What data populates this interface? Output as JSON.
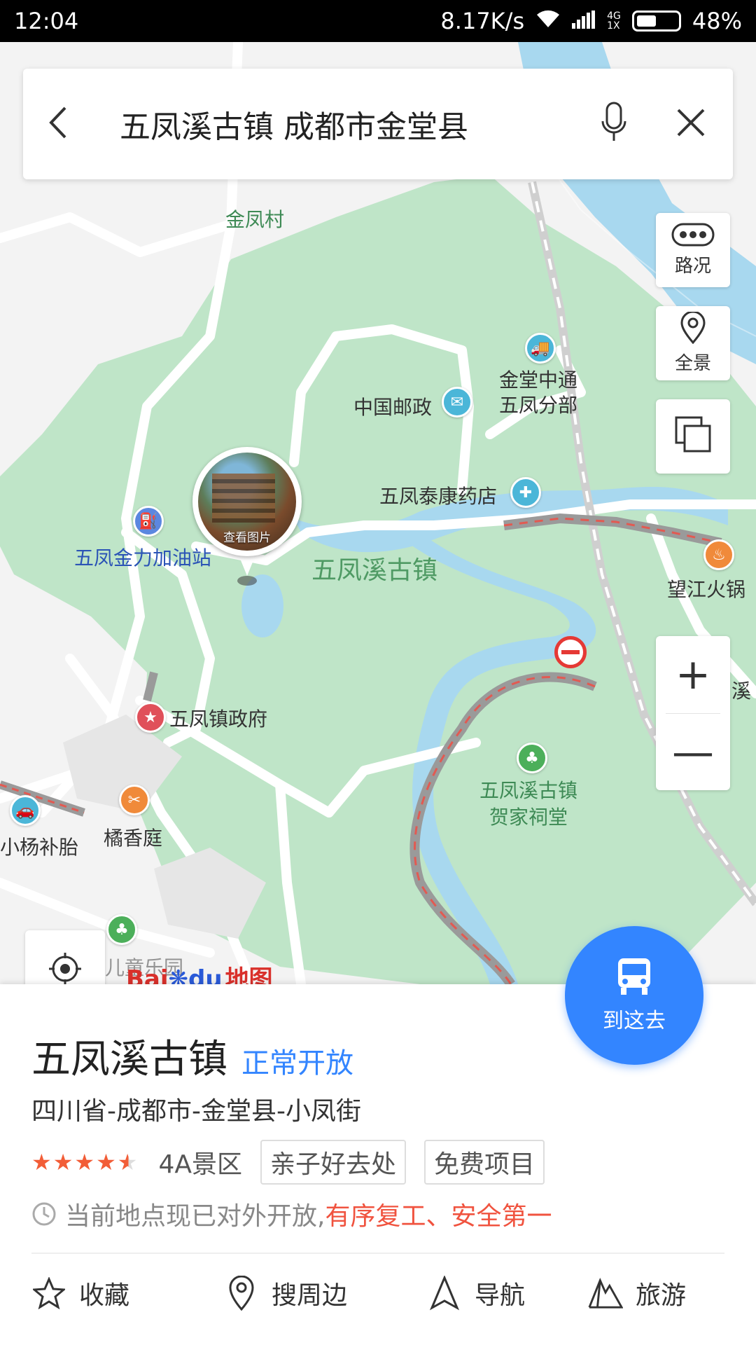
{
  "status_bar": {
    "time": "12:04",
    "speed": "8.17K/s",
    "net_top": "4G",
    "net_bottom": "1X",
    "battery": "48%",
    "battery_level": 0.48
  },
  "search": {
    "query": "五凤溪古镇 成都市金堂县"
  },
  "map": {
    "labels": {
      "village": "金凤村",
      "post": "中国邮政",
      "express": "金堂中通\n五凤分部",
      "pharmacy": "五凤泰康药店",
      "gas": "五凤金力加油站",
      "town": "五凤溪古镇",
      "hotpot": "望江火锅",
      "river_partial": "溪",
      "gov": "五凤镇政府",
      "hall": "五凤溪古镇\n贺家祠堂",
      "restaurant": "橘香庭",
      "tire": "小杨补胎",
      "park": "吴凤溪儿童乐园",
      "photo_caption": "查看图片"
    },
    "controls": {
      "traffic": "路况",
      "panorama": "全景",
      "zoom_in": "+",
      "zoom_out": "—"
    },
    "logo": {
      "bai": "Bai",
      "du": "du",
      "ditu": "地图"
    }
  },
  "go_button": {
    "label": "到这去"
  },
  "place": {
    "name": "五凤溪古镇",
    "status": "正常开放",
    "address": "四川省-成都市-金堂县-小凤街",
    "rating": 4.5,
    "level": "4A景区",
    "tags": [
      "亲子好去处",
      "免费项目"
    ],
    "notice_prefix": "当前地点现已对外开放,",
    "notice_highlight": "有序复工、安全第一"
  },
  "actions": {
    "favorite": "收藏",
    "nearby": "搜周边",
    "navigate": "导航",
    "travel": "旅游"
  },
  "colors": {
    "accent": "#3385ff",
    "highlight": "#f0533f",
    "park_green": "#bfe5c8",
    "river": "#a8d8ef"
  }
}
